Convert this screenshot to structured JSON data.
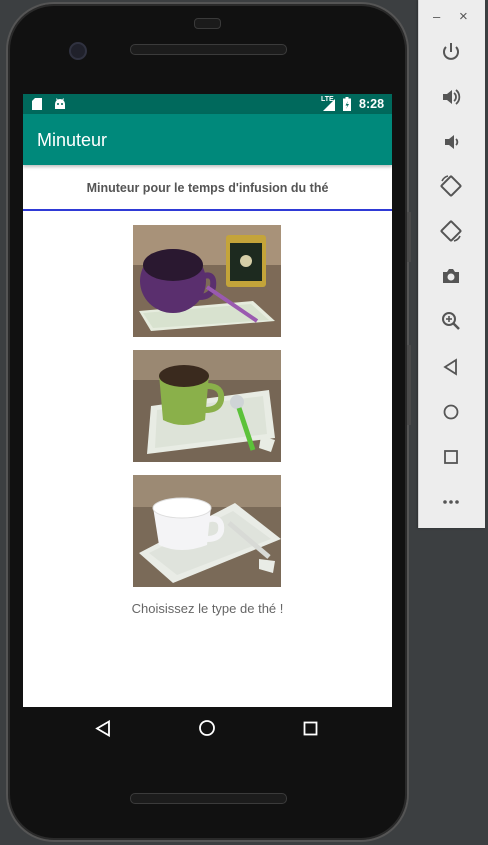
{
  "emulator": {
    "window_controls": {
      "minimize": "–",
      "close": "×"
    },
    "toolbar": [
      {
        "name": "power"
      },
      {
        "name": "volume-up"
      },
      {
        "name": "volume-down"
      },
      {
        "name": "rotate-left"
      },
      {
        "name": "rotate-right"
      },
      {
        "name": "screenshot"
      },
      {
        "name": "zoom"
      },
      {
        "name": "back"
      },
      {
        "name": "home"
      },
      {
        "name": "overview"
      },
      {
        "name": "more"
      }
    ]
  },
  "status_bar": {
    "time": "8:28",
    "network": "LTE"
  },
  "app": {
    "title": "Minuteur",
    "subtitle": "Minuteur pour le temps d'infusion du thé",
    "prompt": "Choisissez le type de thé !",
    "colors": {
      "app_bar": "#00897b",
      "status_bar": "#00695c",
      "divider": "#2f3ad6"
    }
  },
  "tea_options": [
    {
      "name": "purple-cup-tea"
    },
    {
      "name": "green-cup-tea"
    },
    {
      "name": "white-cup-tea"
    }
  ]
}
